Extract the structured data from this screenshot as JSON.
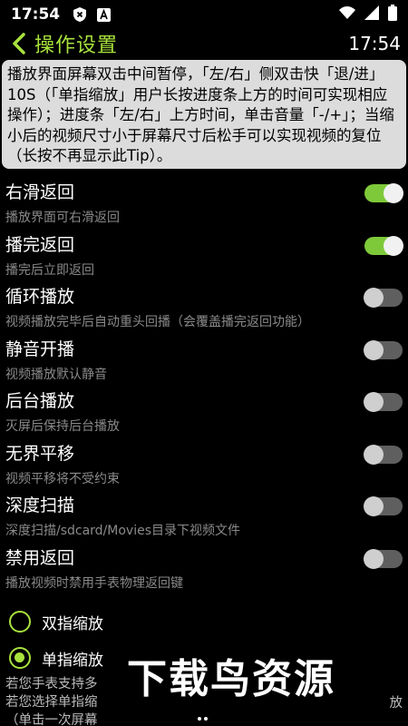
{
  "status_bar": {
    "time": "17:54",
    "icons": [
      "shield-x-icon",
      "a-box-icon"
    ],
    "right_icons": [
      "wifi-icon",
      "signal-icon",
      "battery-icon"
    ]
  },
  "app_bar": {
    "title": "操作设置",
    "clock": "17:54",
    "accent_color": "#a8e23c"
  },
  "tip": {
    "text": "播放界面屏幕双击中间暂停，「左/右」侧双击快「退/进」10S（「单指缩放」用户长按进度条上方的时间可实现相应操作）；进度条「左/右」上方时间，单击音量「-/+」；当缩小后的视频尺寸小于屏幕尺寸后松手可以实现视频的复位（长按不再显示此Tip）。"
  },
  "settings": [
    {
      "title": "右滑返回",
      "subtitle": "播放界面可右滑返回",
      "on": true
    },
    {
      "title": "播完返回",
      "subtitle": "播完后立即返回",
      "on": true
    },
    {
      "title": "循环播放",
      "subtitle": "视频播放完毕后自动重头回播（会覆盖播完返回功能）",
      "on": false
    },
    {
      "title": "静音开播",
      "subtitle": "视频播放默认静音",
      "on": false
    },
    {
      "title": "后台播放",
      "subtitle": "灭屏后保持后台播放",
      "on": false
    },
    {
      "title": "无界平移",
      "subtitle": "视频平移将不受约束",
      "on": false
    },
    {
      "title": "深度扫描",
      "subtitle": "深度扫描/sdcard/Movies目录下视频文件",
      "on": false
    },
    {
      "title": "禁用返回",
      "subtitle": "播放视频时禁用手表物理返回键",
      "on": false
    }
  ],
  "zoom_options": [
    {
      "label": "双指缩放",
      "checked": false
    },
    {
      "label": "单指缩放",
      "checked": true
    }
  ],
  "info": {
    "line1": "若您手表支持多",
    "line2": "若您选择单指缩",
    "line3": "（单击一次屏幕",
    "tail": "放"
  },
  "watermark": "下载鸟资源"
}
